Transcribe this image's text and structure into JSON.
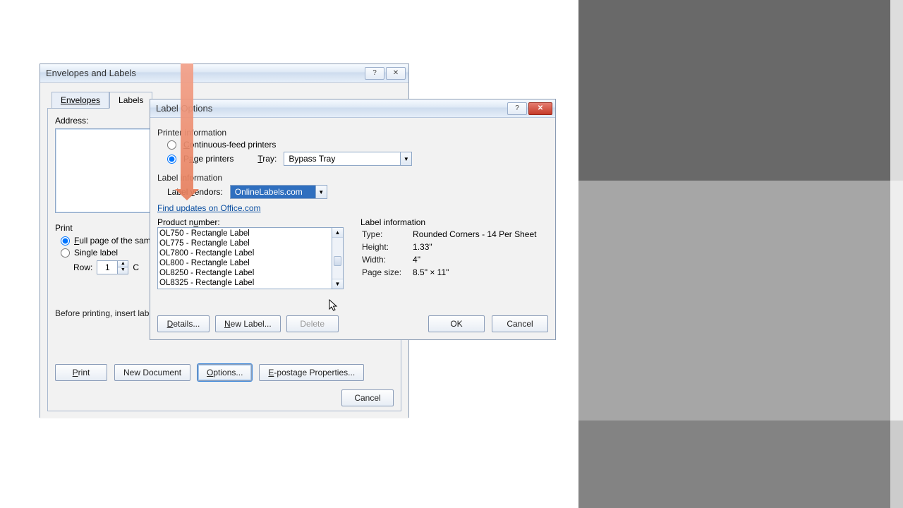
{
  "env_dialog": {
    "title": "Envelopes and Labels",
    "tabs": {
      "envelopes": "Envelopes",
      "labels": "Labels"
    },
    "address_label": "Address:",
    "print_group": "Print",
    "full_page": "Full page of the sam",
    "single": "Single label",
    "row_label": "Row:",
    "row_value": "1",
    "col_frag": "C",
    "hint": "Before printing, insert labels in your printer's manual feeder.",
    "buttons": {
      "print": "Print",
      "new_doc": "New Document",
      "options": "Options...",
      "epostage": "E-postage Properties...",
      "cancel": "Cancel"
    }
  },
  "opt_dialog": {
    "title": "Label Options",
    "printer_sect": "Printer information",
    "cont_feed": "Continuous-feed printers",
    "page_printers": "Page printers",
    "tray_label": "Tray:",
    "tray_value": "Bypass Tray",
    "label_sect": "Label information",
    "vendors_label": "Label vendors:",
    "vendors_value": "OnlineLabels.com",
    "find_updates": "Find updates on Office.com",
    "product_label": "Product number:",
    "products": [
      "OL750 - Rectangle Label",
      "OL775 - Rectangle Label",
      "OL7800 - Rectangle Label",
      "OL800 - Rectangle Label",
      "OL8250 - Rectangle Label",
      "OL8325 - Rectangle Label"
    ],
    "info_header": "Label information",
    "info": {
      "type_k": "Type:",
      "type_v": "Rounded Corners - 14 Per Sheet",
      "height_k": "Height:",
      "height_v": "1.33\"",
      "width_k": "Width:",
      "width_v": "4\"",
      "page_k": "Page size:",
      "page_v": "8.5\" × 11\""
    },
    "buttons": {
      "details": "Details...",
      "new_label": "New Label...",
      "delete": "Delete",
      "ok": "OK",
      "cancel": "Cancel"
    }
  }
}
